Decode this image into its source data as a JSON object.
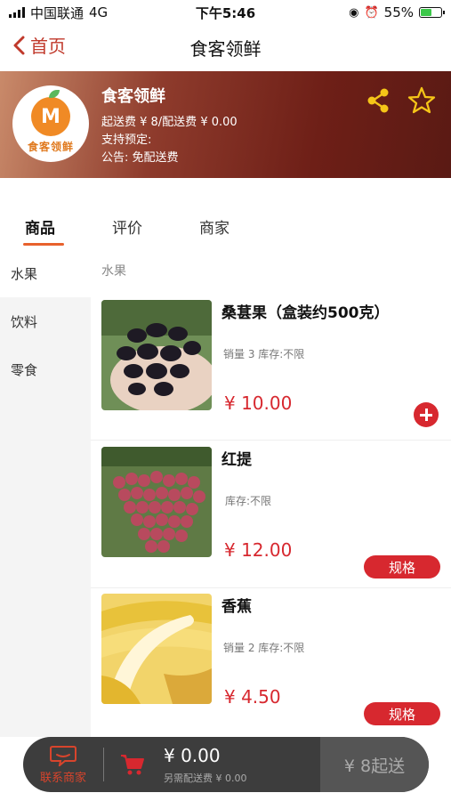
{
  "status_bar": {
    "carrier": "中国联通",
    "network": "4G",
    "time": "下午5:46",
    "battery": "55%"
  },
  "nav": {
    "back_label": "首页",
    "title": "食客领鲜"
  },
  "shop": {
    "logo_text": "食客领鲜",
    "name": "食客领鲜",
    "fees": "起送费 ¥ 8/配送费 ¥ 0.00",
    "reservation": "支持预定:",
    "notice": "公告:   免配送费"
  },
  "tabs": [
    "商品",
    "评价",
    "商家"
  ],
  "categories": [
    "水果",
    "饮料",
    "零食"
  ],
  "section_title": "水果",
  "products": [
    {
      "name": "桑葚果（盒装约500克）",
      "meta": "销量 3 库存:不限",
      "price": "¥ 10.00"
    },
    {
      "name": "红提",
      "meta": "库存:不限",
      "price": "¥ 12.00",
      "spec_label": "规格"
    },
    {
      "name": "香蕉",
      "meta": "销量 2 库存:不限",
      "price": "¥ 4.50",
      "spec_label": "规格"
    }
  ],
  "cart": {
    "contact_label": "联系商家",
    "total": "¥ 0.00",
    "extra_fee": "另需配送费 ¥ 0.00",
    "checkout_label": "¥ 8起送"
  },
  "colors": {
    "accent": "#d7282f",
    "tab_underline": "#e8612c",
    "header_dark": "#6e1f17",
    "icon_yellow": "#f5c518"
  }
}
